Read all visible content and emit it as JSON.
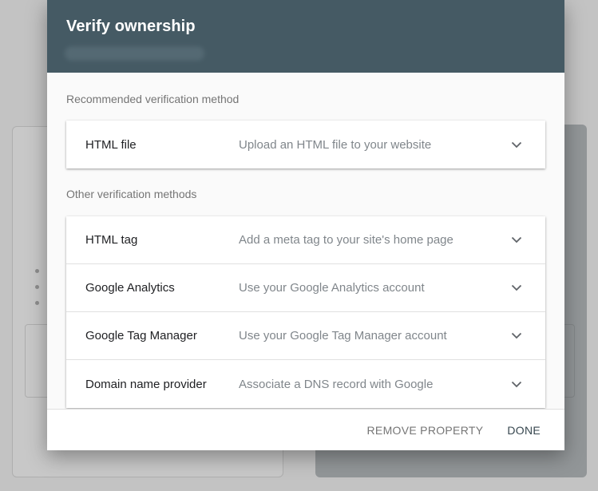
{
  "dialog": {
    "title": "Verify ownership"
  },
  "recommended": {
    "label": "Recommended verification method",
    "methods": [
      {
        "name": "HTML file",
        "description": "Upload an HTML file to your website",
        "icon": "chevron-down-icon"
      }
    ]
  },
  "other": {
    "label": "Other verification methods",
    "methods": [
      {
        "name": "HTML tag",
        "description": "Add a meta tag to your site's home page",
        "icon": "chevron-down-icon"
      },
      {
        "name": "Google Analytics",
        "description": "Use your Google Analytics account",
        "icon": "chevron-down-icon"
      },
      {
        "name": "Google Tag Manager",
        "description": "Use your Google Tag Manager account",
        "icon": "chevron-down-icon"
      },
      {
        "name": "Domain name provider",
        "description": "Associate a DNS record with Google",
        "icon": "chevron-down-icon"
      }
    ]
  },
  "footer": {
    "remove_label": "REMOVE PROPERTY",
    "done_label": "DONE"
  },
  "colors": {
    "header_bg": "#455a64",
    "text_primary": "#202124",
    "text_secondary": "#80868b"
  }
}
